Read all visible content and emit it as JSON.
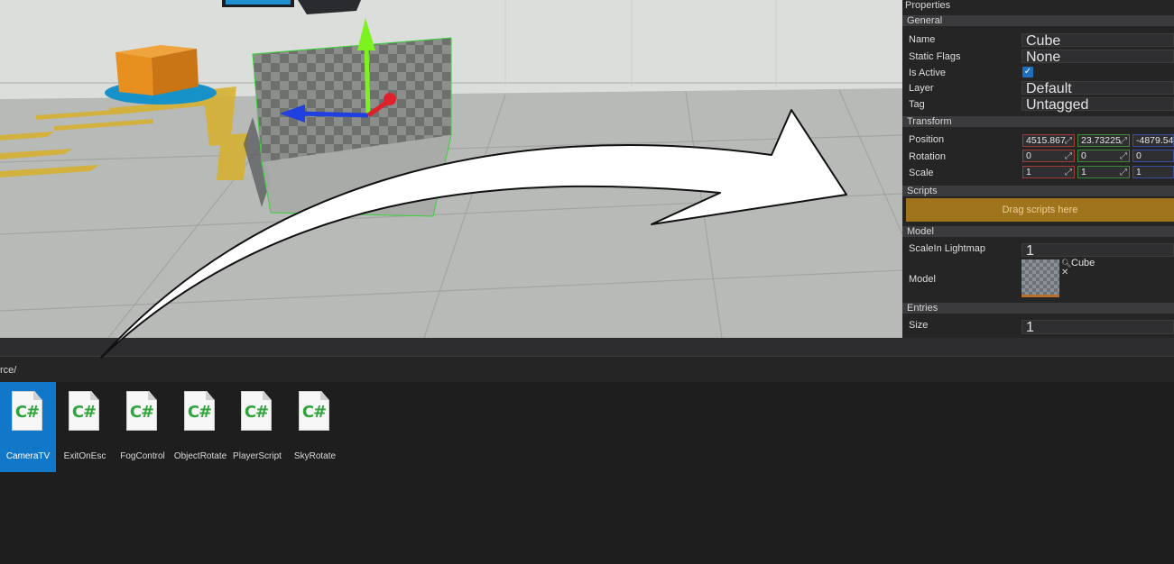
{
  "properties": {
    "title": "Properties",
    "general": {
      "header": "General",
      "name_label": "Name",
      "name_value": "Cube",
      "static_flags_label": "Static Flags",
      "static_flags_value": "None",
      "is_active_label": "Is Active",
      "is_active_checked": true,
      "layer_label": "Layer",
      "layer_value": "Default",
      "tag_label": "Tag",
      "tag_value": "Untagged"
    },
    "transform": {
      "header": "Transform",
      "position_label": "Position",
      "position": [
        "4515.867",
        "23.73225",
        "-4879.54"
      ],
      "rotation_label": "Rotation",
      "rotation": [
        "0",
        "0",
        "0"
      ],
      "scale_label": "Scale",
      "scale": [
        "1",
        "1",
        "1"
      ]
    },
    "scripts": {
      "header": "Scripts",
      "drop_text": "Drag scripts here"
    },
    "model": {
      "header": "Model",
      "scale_lightmap_label": "ScaleIn Lightmap",
      "scale_lightmap_value": "1",
      "model_label": "Model",
      "model_asset_name": "Cube"
    },
    "entries": {
      "header": "Entries",
      "size_label": "Size",
      "size_value": "1"
    }
  },
  "content": {
    "path": "rce/",
    "files": [
      {
        "name": "CameraTV",
        "icon": "csharp-file-icon",
        "selected": true
      },
      {
        "name": "ExitOnEsc",
        "icon": "csharp-file-icon",
        "selected": false
      },
      {
        "name": "FogControl",
        "icon": "csharp-file-icon",
        "selected": false
      },
      {
        "name": "ObjectRotate",
        "icon": "csharp-file-icon",
        "selected": false
      },
      {
        "name": "PlayerScript",
        "icon": "csharp-file-icon",
        "selected": false
      },
      {
        "name": "SkyRotate",
        "icon": "csharp-file-icon",
        "selected": false
      }
    ],
    "file_glyph": "C#"
  },
  "colors": {
    "selection": "#1177c8",
    "drop_zone": "#a0741c",
    "gizmo_x": "#e0202a",
    "gizmo_y": "#7cf21f",
    "gizmo_z": "#2040e0",
    "selection_outline": "#3bd13b"
  }
}
